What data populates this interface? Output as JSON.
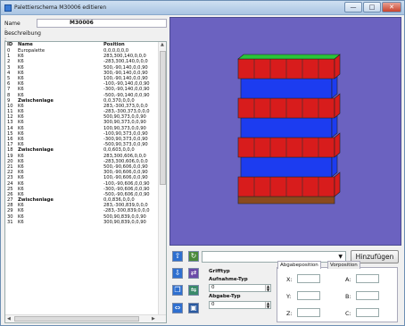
{
  "window": {
    "title": "Palettierschema M30006 editieren",
    "minimize": "—",
    "maximize": "□",
    "close": "✕"
  },
  "form": {
    "name_label": "Name :",
    "name_value": "M30006",
    "desc_label": "Beschreibung :"
  },
  "table": {
    "headers": {
      "id": "ID",
      "name": "Name",
      "position": "Position"
    },
    "rows": [
      {
        "id": "0",
        "name": "Europalette",
        "pos": "0,0,0,0,0,0"
      },
      {
        "id": "1",
        "name": "K6",
        "pos": "283,300,140,0,0,0"
      },
      {
        "id": "2",
        "name": "K6",
        "pos": "-283,300,140,0,0,0"
      },
      {
        "id": "3",
        "name": "K6",
        "pos": "500,-90,140,0,0,90"
      },
      {
        "id": "4",
        "name": "K6",
        "pos": "300,-90,140,0,0,90"
      },
      {
        "id": "5",
        "name": "K6",
        "pos": "100,-90,140,0,0,90"
      },
      {
        "id": "6",
        "name": "K6",
        "pos": "-100,-90,140,0,0,90"
      },
      {
        "id": "7",
        "name": "K6",
        "pos": "-300,-90,140,0,0,90"
      },
      {
        "id": "8",
        "name": "K6",
        "pos": "-500,-90,140,0,0,90"
      },
      {
        "id": "9",
        "name": "Zwischenlage",
        "pos": "0,0,370,0,0,0"
      },
      {
        "id": "10",
        "name": "K6",
        "pos": "283,-300,373,0,0,0"
      },
      {
        "id": "11",
        "name": "K6",
        "pos": "-283,-300,373,0,0,0"
      },
      {
        "id": "12",
        "name": "K6",
        "pos": "500,90,373,0,0,90"
      },
      {
        "id": "13",
        "name": "K6",
        "pos": "300,90,373,0,0,90"
      },
      {
        "id": "14",
        "name": "K6",
        "pos": "100,90,373,0,0,90"
      },
      {
        "id": "15",
        "name": "K6",
        "pos": "-100,90,373,0,0,90"
      },
      {
        "id": "16",
        "name": "K6",
        "pos": "-300,90,373,0,0,90"
      },
      {
        "id": "17",
        "name": "K6",
        "pos": "-500,90,373,0,0,90"
      },
      {
        "id": "18",
        "name": "Zwischenlage",
        "pos": "0,0,603,0,0,0"
      },
      {
        "id": "19",
        "name": "K6",
        "pos": "283,300,606,0,0,0"
      },
      {
        "id": "20",
        "name": "K6",
        "pos": "-283,300,606,0,0,0"
      },
      {
        "id": "21",
        "name": "K6",
        "pos": "500,-90,606,0,0,90"
      },
      {
        "id": "22",
        "name": "K6",
        "pos": "300,-90,606,0,0,90"
      },
      {
        "id": "23",
        "name": "K6",
        "pos": "100,-90,606,0,0,90"
      },
      {
        "id": "24",
        "name": "K6",
        "pos": "-100,-90,606,0,0,90"
      },
      {
        "id": "25",
        "name": "K6",
        "pos": "-300,-90,606,0,0,90"
      },
      {
        "id": "26",
        "name": "K6",
        "pos": "-500,-90,606,0,0,90"
      },
      {
        "id": "27",
        "name": "Zwischenlage",
        "pos": "0,0,836,0,0,0"
      },
      {
        "id": "28",
        "name": "K6",
        "pos": "283,-300,839,0,0,0"
      },
      {
        "id": "29",
        "name": "K6",
        "pos": "-283,-300,839,0,0,0"
      },
      {
        "id": "30",
        "name": "K6",
        "pos": "500,90,839,0,0,90"
      },
      {
        "id": "31",
        "name": "K6",
        "pos": "300,90,839,0,0,90"
      }
    ]
  },
  "viewer": {
    "background": "#6b62c0",
    "colors": {
      "red": "#d81c1c",
      "blue": "#1c3cf0",
      "green": "#29c43a",
      "wood": "#8a4a1e"
    },
    "layers_bottom_to_top": [
      "red",
      "blue",
      "red",
      "blue",
      "red",
      "blue",
      "red"
    ],
    "top_color": "green",
    "pallet": "wood"
  },
  "controls": {
    "dropdown_value": "",
    "add_button": "Hinzufügen",
    "grifftyp_label": "Grifftyp",
    "aufnahme_label": "Aufnahme-Typ",
    "aufnahme_value": "0",
    "abgabe_label": "Abgabe-Typ",
    "abgabe_value": "0",
    "tab_active": "Abgabeposition",
    "tab_inactive": "Vorposition",
    "coords": {
      "x": "X:",
      "y": "Y:",
      "z": "Z:",
      "a": "A:",
      "b": "B:",
      "c": "C:"
    }
  }
}
